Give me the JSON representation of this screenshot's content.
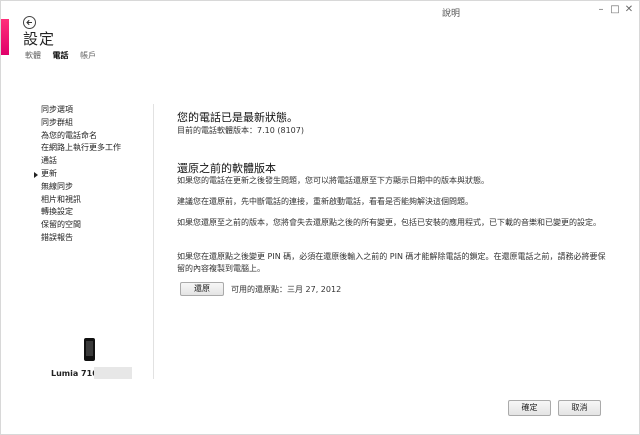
{
  "window": {
    "title": "說明",
    "minimize_glyph": "–",
    "maximize_glyph": "□",
    "close_glyph": "✕",
    "accent_color": "#e0006a"
  },
  "header": {
    "back_icon": "back-arrow-icon",
    "title": "設定",
    "tabs": [
      {
        "label": "軟體"
      },
      {
        "label": "電話"
      },
      {
        "label": "帳戶"
      }
    ],
    "active_tab": "電話"
  },
  "sidebar": {
    "items": [
      {
        "label": "同步選項"
      },
      {
        "label": "同步群組"
      },
      {
        "label": "為您的電話命名"
      },
      {
        "label": "在網路上執行更多工作"
      },
      {
        "label": "通話"
      },
      {
        "label": "更新"
      },
      {
        "label": "無線同步"
      },
      {
        "label": "相片和視訊"
      },
      {
        "label": "轉換設定"
      },
      {
        "label": "保留的空間"
      },
      {
        "label": "錯誤報告"
      }
    ],
    "active_item": "更新",
    "device_name": "Lumia 710"
  },
  "main": {
    "status_title": "您的電話已是最新狀態。",
    "status_version": "目前的電話軟體版本：7.10 (8107)",
    "restore_heading": "還原之前的軟體版本",
    "paragraphs": [
      "如果您的電話在更新之後發生問題，您可以將電話還原至下方顯示日期中的版本與狀態。",
      "建議您在還原前，先中斷電話的連接，重新啟動電話，看看是否能夠解決這個問題。",
      "如果您還原至之前的版本，您將會失去還原點之後的所有變更，包括已安裝的應用程式，已下載的音樂和已變更的設定。",
      "如果您在還原點之後變更 PIN 碼，必須在還原後輸入之前的 PIN 碼才能解除電話的鎖定。在還原電話之前，請務必將要保留的內容複製到電腦上。"
    ],
    "restore_button": "還原",
    "restore_point": "可用的還原點：三月 27, 2012"
  },
  "footer": {
    "ok_label": "確定",
    "cancel_label": "取消"
  }
}
